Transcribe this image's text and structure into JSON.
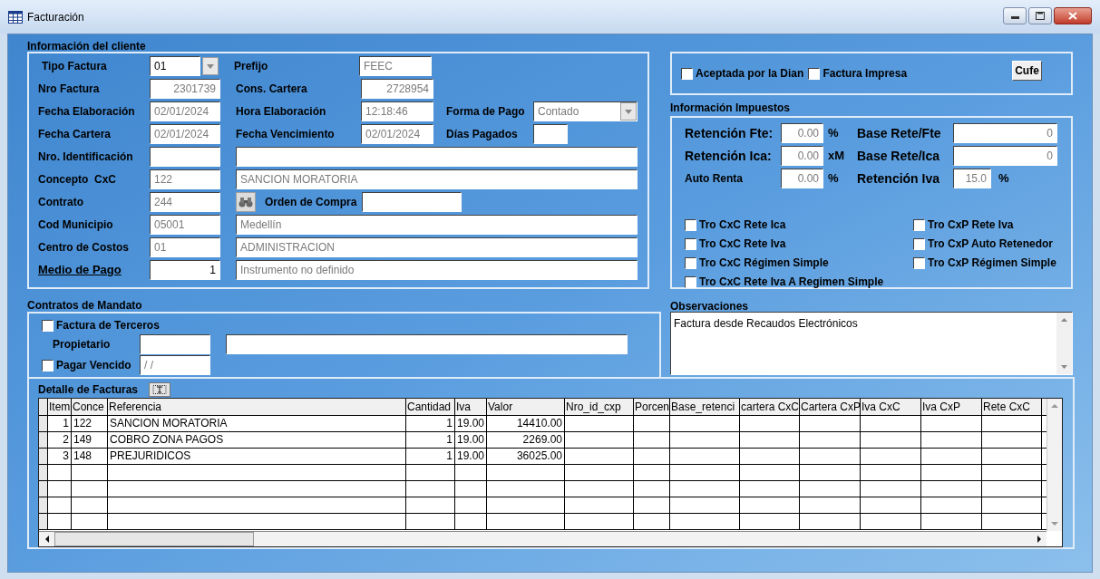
{
  "window": {
    "title": "Facturación"
  },
  "cliente": {
    "title": "Información del cliente",
    "tipo_factura": {
      "label": "Tipo Factura",
      "value": "01"
    },
    "prefijo": {
      "label": "Prefijo",
      "value": "FEEC"
    },
    "nro_factura": {
      "label": "Nro Factura",
      "value": "2301739"
    },
    "cons_cartera": {
      "label": "Cons. Cartera",
      "value": "2728954"
    },
    "fecha_elaboracion": {
      "label": "Fecha Elaboración",
      "value": "02/01/2024"
    },
    "hora_elaboracion": {
      "label": "Hora Elaboración",
      "value": "12:18:46"
    },
    "forma_pago": {
      "label": "Forma de Pago",
      "value": "Contado"
    },
    "fecha_cartera": {
      "label": "Fecha Cartera",
      "value": "02/01/2024"
    },
    "fecha_vencimiento": {
      "label": "Fecha Vencimiento",
      "value": "02/01/2024"
    },
    "dias_pagados": {
      "label": "Días Pagados"
    },
    "nro_identificacion": {
      "label": "Nro. Identificación"
    },
    "concepto": {
      "label": "Concepto  CxC",
      "code": "122",
      "name": "SANCION MORATORIA"
    },
    "contrato": {
      "label": "Contrato",
      "value": "244"
    },
    "orden_compra": {
      "label": "Orden de Compra"
    },
    "municipio": {
      "label": "Cod Municipio",
      "code": "05001",
      "name": "Medellín"
    },
    "centro_costos": {
      "label": "Centro de Costos",
      "code": "01",
      "name": "ADMINISTRACION"
    },
    "medio_pago": {
      "label": "Medio de Pago",
      "code": "1",
      "name": "Instrumento no definido"
    }
  },
  "estado": {
    "checks": [
      {
        "label": "Aceptada por la Dian",
        "checked": false
      },
      {
        "label": "Factura Impresa",
        "checked": false
      }
    ],
    "cufe_button": "Cufe"
  },
  "impuestos": {
    "title": "Información Impuestos",
    "retencion_fte": {
      "label": "Retención Fte:",
      "value": "0.00",
      "unit": "%"
    },
    "base_rete_fte": {
      "label": "Base Rete/Fte",
      "value": "0"
    },
    "retencion_ica": {
      "label": "Retención Ica:",
      "value": "0.00",
      "unit": "xM"
    },
    "base_rete_ica": {
      "label": "Base Rete/Ica",
      "value": "0"
    },
    "auto_renta": {
      "label": "Auto Renta",
      "value": "0.00",
      "unit": "%"
    },
    "retencion_iva": {
      "label": "Retención Iva",
      "value": "15.0",
      "unit": "%"
    },
    "checks_left": [
      {
        "label": "Tro CxC Rete Ica",
        "checked": false
      },
      {
        "label": "Tro CxC Rete Iva",
        "checked": false
      },
      {
        "label": "Tro CxC Régimen Simple",
        "checked": false
      },
      {
        "label": "Tro CxC Rete Iva A Regimen Simple",
        "checked": false
      }
    ],
    "checks_right": [
      {
        "label": "Tro CxP Rete Iva",
        "checked": false
      },
      {
        "label": "Tro CxP Auto Retenedor",
        "checked": false
      },
      {
        "label": "Tro CxP Régimen Simple",
        "checked": false
      }
    ]
  },
  "mandato": {
    "title": "Contratos de Mandato",
    "factura_terceros": {
      "label": "Factura de Terceros",
      "checked": false
    },
    "propietario": {
      "label": "Propietario"
    },
    "pagar_vencido": {
      "label": "Pagar Vencido",
      "checked": false,
      "value": "/ /"
    }
  },
  "observaciones": {
    "title": "Observaciones",
    "value": "Factura desde Recaudos Electrónicos"
  },
  "detalle": {
    "title": "Detalle de Facturas",
    "columns": [
      "Item",
      "Conce",
      "Referencia",
      "Cantidad",
      "Iva",
      "Valor",
      "Nro_id_cxp",
      "Porcen",
      "Base_retenci",
      "cartera CxC",
      "Cartera CxP",
      "Iva CxC",
      "Iva CxP",
      "Rete CxC"
    ],
    "rows": [
      [
        "1",
        "122",
        "SANCION MORATORIA",
        "1",
        "19.00",
        "14410.00"
      ],
      [
        "2",
        "149",
        "COBRO ZONA PAGOS",
        "1",
        "19.00",
        "2269.00"
      ],
      [
        "3",
        "148",
        "PREJURIDICOS",
        "1",
        "19.00",
        "36025.00"
      ]
    ]
  }
}
